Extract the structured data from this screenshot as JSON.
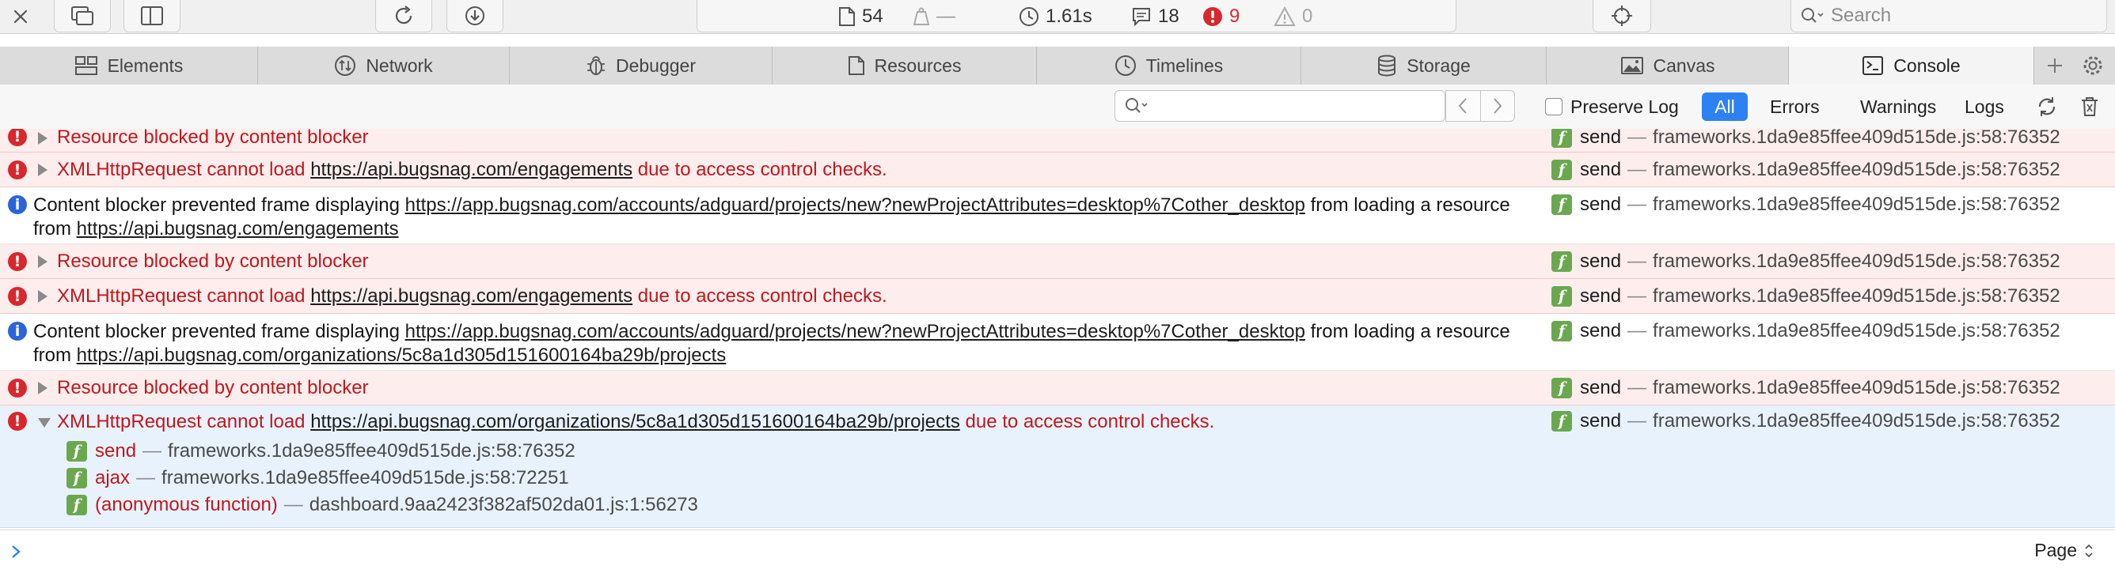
{
  "toolbar": {
    "activity": {
      "resources_count": "54",
      "size_value": "—",
      "load_time": "1.61s",
      "logs_count": "18",
      "errors_count": "9",
      "warnings_count": "0"
    },
    "search_placeholder": "Search"
  },
  "tabs": [
    {
      "label": "Elements",
      "icon": "elements-icon"
    },
    {
      "label": "Network",
      "icon": "network-icon"
    },
    {
      "label": "Debugger",
      "icon": "debugger-icon"
    },
    {
      "label": "Resources",
      "icon": "resources-icon"
    },
    {
      "label": "Timelines",
      "icon": "timelines-icon"
    },
    {
      "label": "Storage",
      "icon": "storage-icon"
    },
    {
      "label": "Canvas",
      "icon": "canvas-icon"
    },
    {
      "label": "Console",
      "icon": "console-icon",
      "active": true
    }
  ],
  "filter": {
    "preserve_log_label": "Preserve Log",
    "buttons": [
      "All",
      "Errors",
      "Warnings",
      "Logs"
    ],
    "active_button": "All"
  },
  "console": {
    "messages": [
      {
        "level": "error",
        "collapsed": true,
        "text": "Resource blocked by content blocker"
      },
      {
        "level": "error",
        "collapsed": true,
        "prefix": "XMLHttpRequest cannot load ",
        "url": "https://api.bugsnag.com/engagements",
        "suffix": " due to access control checks."
      },
      {
        "level": "info",
        "prefix": "Content blocker prevented frame displaying ",
        "url": "https://app.bugsnag.com/accounts/adguard/projects/new?newProjectAttributes=desktop%7Cother_desktop",
        "middle": " from loading a resource from ",
        "url2": "https://api.bugsnag.com/engagements"
      },
      {
        "level": "error",
        "collapsed": true,
        "text": "Resource blocked by content blocker"
      },
      {
        "level": "error",
        "collapsed": true,
        "prefix": "XMLHttpRequest cannot load ",
        "url": "https://api.bugsnag.com/engagements",
        "suffix": " due to access control checks."
      },
      {
        "level": "info",
        "prefix": "Content blocker prevented frame displaying ",
        "url": "https://app.bugsnag.com/accounts/adguard/projects/new?newProjectAttributes=desktop%7Cother_desktop",
        "middle": " from loading a resource from ",
        "url2": "https://api.bugsnag.com/organizations/5c8a1d305d151600164ba29b/projects"
      },
      {
        "level": "error",
        "collapsed": true,
        "text": "Resource blocked by content blocker"
      },
      {
        "level": "error",
        "collapsed": false,
        "prefix": "XMLHttpRequest cannot load ",
        "url": "https://api.bugsnag.com/organizations/5c8a1d305d151600164ba29b/projects",
        "suffix": " due to access control checks."
      }
    ],
    "location": {
      "function": "send",
      "file": "frameworks.1da9e85ffee409d515de.js:58:76352"
    },
    "stack": [
      {
        "function": "send",
        "file": "frameworks.1da9e85ffee409d515de.js:58:76352"
      },
      {
        "function": "ajax",
        "file": "frameworks.1da9e85ffee409d515de.js:58:72251"
      },
      {
        "function": "(anonymous function)",
        "file": "dashboard.9aa2423f382af502da01.js:1:56273"
      }
    ]
  },
  "prompt": {
    "context_label": "Page"
  },
  "colors": {
    "error_text": "#c0181d",
    "error_bg": "#fdeded",
    "expanded_bg": "#e8f2fd",
    "accent": "#2d81f2",
    "function_badge": "#6aa84f"
  }
}
